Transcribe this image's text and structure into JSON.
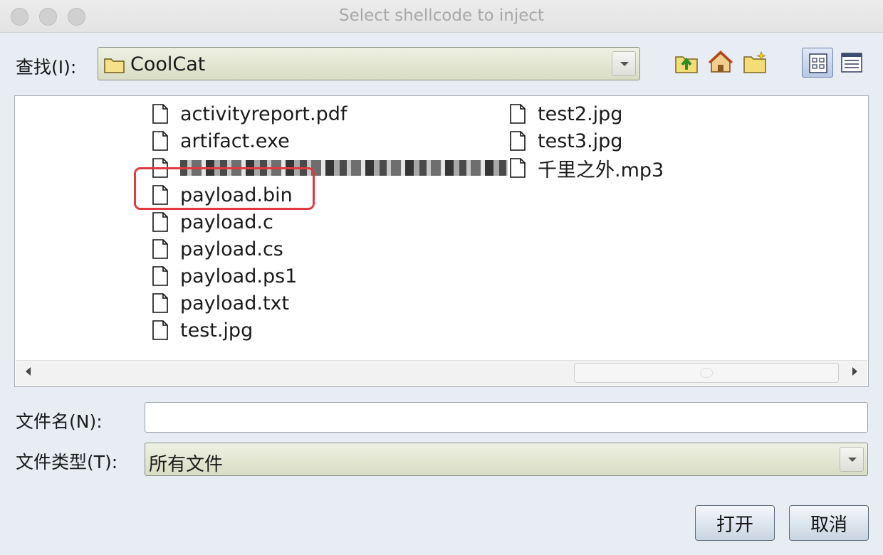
{
  "window": {
    "title": "Select shellcode to inject"
  },
  "lookin": {
    "label": "查找(I):",
    "value": "CoolCat"
  },
  "toolbar": {
    "icons": [
      "up-folder-icon",
      "home-icon",
      "new-folder-icon",
      "list-view-icon",
      "details-view-icon"
    ]
  },
  "files": {
    "column1": [
      {
        "name": "activityreport.pdf"
      },
      {
        "name": "artifact.exe"
      },
      {
        "name": "",
        "redacted": true
      },
      {
        "name": "payload.bin",
        "highlighted": true
      },
      {
        "name": "payload.c"
      },
      {
        "name": "payload.cs"
      },
      {
        "name": "payload.ps1"
      },
      {
        "name": "payload.txt"
      },
      {
        "name": "test.jpg"
      }
    ],
    "column2": [
      {
        "name": "test2.jpg"
      },
      {
        "name": "test3.jpg"
      },
      {
        "name": "千里之外.mp3"
      }
    ]
  },
  "filename": {
    "label": "文件名(N):",
    "value": ""
  },
  "filetype": {
    "label": "文件类型(T):",
    "value": "所有文件"
  },
  "buttons": {
    "open": "打开",
    "cancel": "取消"
  },
  "colors": {
    "highlight": "#e0393e",
    "selected_view": "#b9c9e3"
  }
}
